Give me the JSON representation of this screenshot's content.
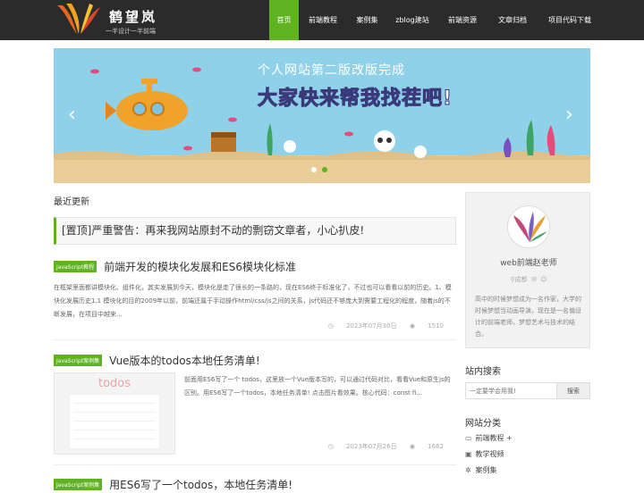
{
  "header": {
    "logo_title": "鹤望岚",
    "logo_sub": "一半设计一半前端",
    "nav": [
      {
        "label": "首页",
        "active": true
      },
      {
        "label": "前端教程"
      },
      {
        "label": "案例集"
      },
      {
        "label": "zblog建站"
      },
      {
        "label": "前端资源"
      },
      {
        "label": "文章归档"
      },
      {
        "label": "项目代码下载"
      }
    ]
  },
  "banner": {
    "line1": "个人网站第二版改版完成",
    "line2_pre": "大家快来帮我",
    "line2_hl": "找茬",
    "line2_post": "吧!",
    "prev": "‹",
    "next": "›"
  },
  "main": {
    "section_title": "最近更新",
    "pinned": "[置顶]严重警告：再来我网站原封不动的剽窃文章者，小心扒皮!",
    "articles": [
      {
        "tag": "JavaScript教程",
        "title": "前端开发的模块化发展和ES6模块化标准",
        "excerpt": "在框架里面都讲模块化、组件化，其实发展到今天，模块化是走了很长的一条路的，现在ES6终于标准化了，不过也可以看看以前的历史。1、模块化发展历史1.1 模块化的目的2009年以前，前端还属于手动操作html/css/js之间的关系，js代码还不够庞大到需要工程化的程度，随着js的不断发展，在项目中越来...",
        "date": "2023年07月30日",
        "views": "1510"
      },
      {
        "tag": "JavaScript案例集",
        "title": "Vue版本的todos本地任务清单!",
        "excerpt": "前面用ES6写了一个 todos，这里放一个Vue版本写的，可以通过代码对比，看看Vue和原生js的区别。用ES6写了一个todos，本地任务清单! 点击图片看效果。核心代码：const fi...",
        "date": "2023年07月26日",
        "views": "1662",
        "thumb_title": "todos"
      },
      {
        "tag": "JavaScript案例集",
        "title": "用ES6写了一个todos，本地任务清单!"
      }
    ]
  },
  "sidebar": {
    "name": "web前端赵老师",
    "location": "成都",
    "desc": "高中的时候梦想成为一名作家，大学的时候梦想当动画导演，现在是一名偏设计的前端老师，梦想艺术与技术的结合。",
    "search_title": "站内搜索",
    "search_placeholder": "一定要学会用我!",
    "search_button": "搜索",
    "cat_title": "网站分类",
    "categories": [
      {
        "icon": "folder-icon",
        "label": "前端教程",
        "expand": "+"
      },
      {
        "icon": "video-icon",
        "label": "教学视频"
      },
      {
        "icon": "star-icon",
        "label": "案例集"
      }
    ]
  },
  "colors": {
    "accent": "#5fb221",
    "header_bg": "#2b2b2b"
  }
}
